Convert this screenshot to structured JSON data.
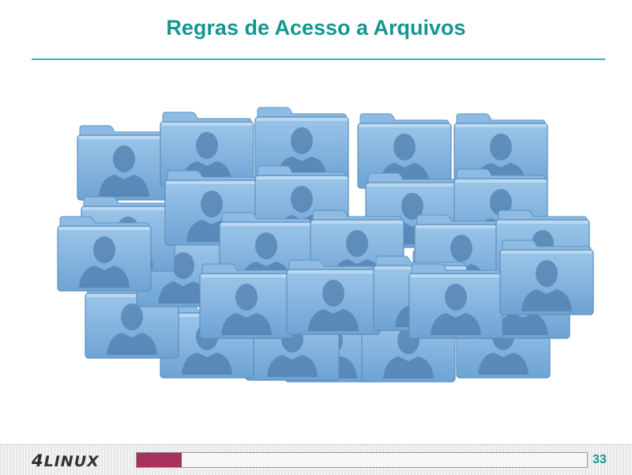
{
  "slide": {
    "title": "Regras de Acesso a Arquivos",
    "page_number": "33",
    "progress_fraction": 0.1
  },
  "footer": {
    "logo_prefix": "4",
    "logo_text": "LINUX"
  },
  "folders": {
    "icon": "user-folder-icon",
    "count": 30,
    "color": "#7fb3df"
  },
  "colors": {
    "title": "#14968f",
    "rule": "#2ab7c0",
    "progress": "#a8315e"
  }
}
